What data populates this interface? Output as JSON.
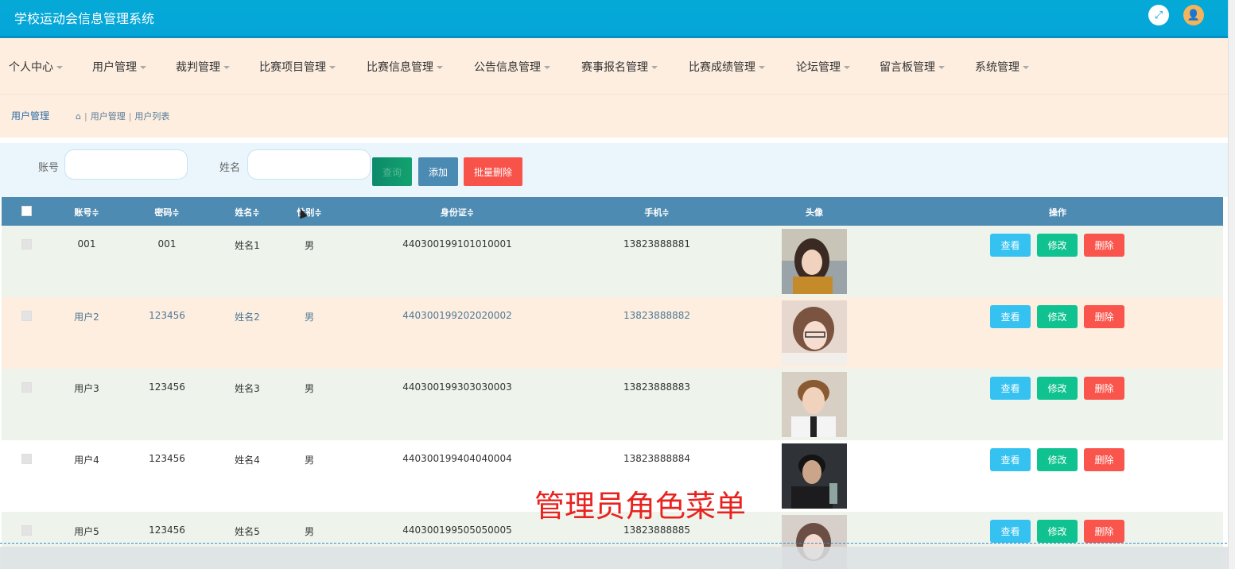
{
  "app": {
    "title": "学校运动会信息管理系统",
    "fullscreen_icon": "⤢",
    "user_icon": "👤"
  },
  "menu": [
    {
      "label": "个人中心"
    },
    {
      "label": "用户管理"
    },
    {
      "label": "裁判管理"
    },
    {
      "label": "比赛项目管理"
    },
    {
      "label": "比赛信息管理"
    },
    {
      "label": "公告信息管理"
    },
    {
      "label": "赛事报名管理"
    },
    {
      "label": "比赛成绩管理"
    },
    {
      "label": "论坛管理"
    },
    {
      "label": "留言板管理"
    },
    {
      "label": "系统管理"
    }
  ],
  "breadcrumb": {
    "title": "用户管理",
    "home_icon": "⌂",
    "items": [
      "用户管理",
      "用户列表"
    ]
  },
  "search": {
    "account_label": "账号",
    "name_label": "姓名",
    "search_button": "查询",
    "add_button": "添加",
    "batch_delete_button": "批量删除"
  },
  "table": {
    "headers": [
      "账号≑",
      "密码≑",
      "姓名≑",
      "性别≑",
      "身份证≑",
      "手机≑",
      "头像",
      "操作"
    ],
    "rows": [
      {
        "account": "001",
        "password": "001",
        "name": "姓名1",
        "gender": "男",
        "id_card": "440300199101010001",
        "phone": "13823888881"
      },
      {
        "account": "用户2",
        "password": "123456",
        "name": "姓名2",
        "gender": "男",
        "id_card": "440300199202020002",
        "phone": "13823888882"
      },
      {
        "account": "用户3",
        "password": "123456",
        "name": "姓名3",
        "gender": "男",
        "id_card": "440300199303030003",
        "phone": "13823888883"
      },
      {
        "account": "用户4",
        "password": "123456",
        "name": "姓名4",
        "gender": "男",
        "id_card": "440300199404040004",
        "phone": "13823888884"
      },
      {
        "account": "用户5",
        "password": "123456",
        "name": "姓名5",
        "gender": "男",
        "id_card": "440300199505050005",
        "phone": "13823888885"
      }
    ],
    "actions": {
      "view": "查看",
      "edit": "修改",
      "delete": "删除"
    }
  },
  "overlay": {
    "caption": "管理员角色菜单"
  },
  "colors": {
    "topbar": "#04a6d9",
    "menubar": "#fdeee0",
    "table_header": "#4e8bb2",
    "view": "#35c2f0",
    "edit": "#0fc28f",
    "delete": "#f9554c",
    "caption": "#e8231f"
  }
}
